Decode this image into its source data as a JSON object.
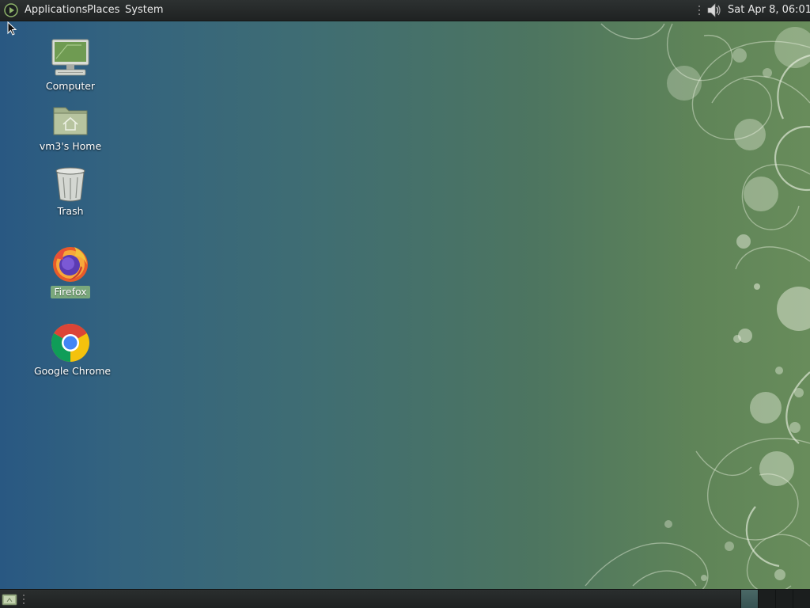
{
  "top_panel": {
    "menus": {
      "applications": "Applications",
      "places": "Places",
      "system": "System"
    },
    "clock": "Sat Apr  8, 06:01",
    "icons": {
      "logo": "gnome-foot-icon",
      "volume": "speaker-volume-icon"
    }
  },
  "desktop": {
    "icons": [
      {
        "label": "Computer",
        "icon": "computer-icon",
        "selected": false
      },
      {
        "label": "vm3's Home",
        "icon": "home-folder-icon",
        "selected": false
      },
      {
        "label": "Trash",
        "icon": "trash-icon",
        "selected": false
      },
      {
        "label": "Firefox",
        "icon": "firefox-icon",
        "selected": true
      },
      {
        "label": "Google Chrome",
        "icon": "chrome-icon",
        "selected": false
      }
    ]
  },
  "bottom_panel": {
    "show_desktop_icon": "show-desktop-icon",
    "workspaces": [
      {
        "active": true
      },
      {
        "active": false
      },
      {
        "active": false
      },
      {
        "active": false
      }
    ]
  },
  "colors": {
    "panel": "#2d3131",
    "selection": "#7aa87c",
    "wallpaper_left": "#295882",
    "wallpaper_right": "#688c5b"
  }
}
